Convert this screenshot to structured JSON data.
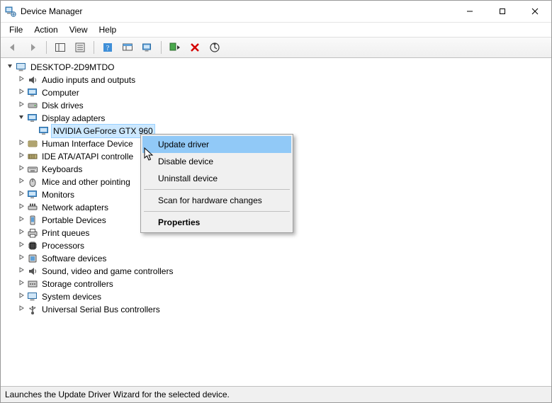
{
  "window": {
    "title": "Device Manager"
  },
  "menubar": {
    "file": "File",
    "action": "Action",
    "view": "View",
    "help": "Help"
  },
  "tree": {
    "root": "DESKTOP-2D9MTDO",
    "audio": "Audio inputs and outputs",
    "computer": "Computer",
    "disk": "Disk drives",
    "display": "Display adapters",
    "gpu": "NVIDIA GeForce GTX 960",
    "hid": "Human Interface Device",
    "ide": "IDE ATA/ATAPI controlle",
    "keyboards": "Keyboards",
    "mice": "Mice and other pointing",
    "monitors": "Monitors",
    "network": "Network adapters",
    "portable": "Portable Devices",
    "printq": "Print queues",
    "processors": "Processors",
    "software": "Software devices",
    "sound": "Sound, video and game controllers",
    "storage": "Storage controllers",
    "system": "System devices",
    "usb": "Universal Serial Bus controllers"
  },
  "context_menu": {
    "update": "Update driver",
    "disable": "Disable device",
    "uninstall": "Uninstall device",
    "scan": "Scan for hardware changes",
    "properties": "Properties"
  },
  "statusbar": {
    "text": "Launches the Update Driver Wizard for the selected device."
  }
}
